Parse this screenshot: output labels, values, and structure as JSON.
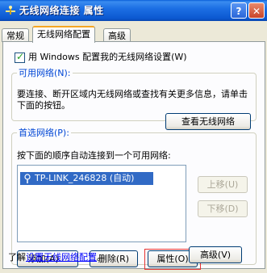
{
  "window": {
    "title": "无线网络连接 属性",
    "help_label": "?",
    "close_label": "✕"
  },
  "tabs": [
    {
      "label": "常规",
      "active": false
    },
    {
      "label": "无线网络配置",
      "active": true
    },
    {
      "label": "高级",
      "active": false
    }
  ],
  "use_windows": {
    "label": "用 Windows 配置我的无线网络设置(W)",
    "checked": true
  },
  "available": {
    "legend": "可用网络(N):",
    "description": "要连接、断开区域内无线网络或查找有关更多信息，请单击下面的按钮。",
    "view_button": "查看无线网络"
  },
  "preferred": {
    "legend": "首选网络(P):",
    "description": "按下面的顺序自动连接到一个可用网络:",
    "networks": [
      {
        "label": "TP-LINK_246828 (自动)",
        "selected": true
      }
    ],
    "move_up": "上移(U)",
    "move_down": "下移(D)",
    "add": "添加(A)...",
    "remove": "删除(R)",
    "properties": "属性(O)"
  },
  "footer": {
    "learn_prefix": "了解",
    "learn_link": "设置无线网络配置",
    "learn_suffix": "。",
    "advanced": "高级(V)"
  },
  "colors": {
    "titlebar": "#0b58d0",
    "selection": "#316ac5",
    "group_label": "#0046d5",
    "highlight_box": "#e53333",
    "active_tab_accent": "#f5a623"
  }
}
